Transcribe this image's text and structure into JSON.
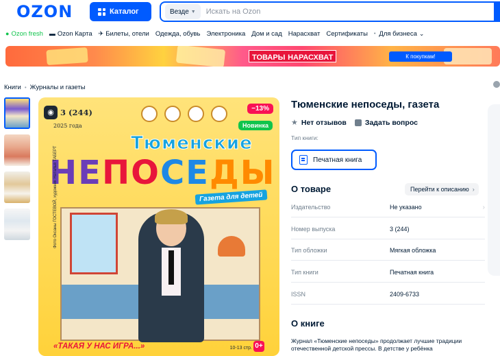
{
  "header": {
    "logo": "OZON",
    "catalog_label": "Каталог",
    "search_scope": "Везде",
    "search_placeholder": "Искать на Ozon"
  },
  "nav": {
    "items": [
      {
        "label": "Ozon fresh",
        "icon": "fresh-icon"
      },
      {
        "label": "Ozon Карта",
        "icon": "card-icon"
      },
      {
        "label": "Билеты, отели",
        "icon": "plane-icon"
      },
      {
        "label": "Одежда, обувь"
      },
      {
        "label": "Электроника"
      },
      {
        "label": "Дом и сад"
      },
      {
        "label": "Нарасхват"
      },
      {
        "label": "Сертификаты"
      },
      {
        "label": "Для бизнеса"
      }
    ]
  },
  "banner": {
    "title_main": "ТОВАРЫ",
    "title_sub": "НАРАСХВАТ",
    "cta": "К покупкам!"
  },
  "breadcrumbs": [
    "Книги",
    "Журналы и газеты"
  ],
  "cover": {
    "issue": "3 (244)",
    "year": "2025 года",
    "discount": "−13%",
    "new_badge": "Новинка",
    "title_top": "Тюменские",
    "title_big": [
      "НЕ",
      "ПО",
      "СЕ",
      "ДЫ"
    ],
    "subtitle": "Газета для детей",
    "bottom_text": "«ТАКАЯ У НАС ИГРА...»",
    "pages": "10-13 стр.",
    "age": "0+",
    "credit": "Фото Оксаны ГОСТЕВОЙ, художник Наталья ТАБЕРТ"
  },
  "product": {
    "title": "Тюменские непоседы, газета",
    "reviews": "Нет отзывов",
    "ask": "Задать вопрос",
    "book_type_label": "Тип книги:",
    "book_type_value": "Печатная книга"
  },
  "about_product": {
    "title": "О товаре",
    "goto": "Перейти к описанию",
    "specs": [
      {
        "key": "Издательство",
        "value": "Не указано"
      },
      {
        "key": "Номер выпуска",
        "value": "3 (244)"
      },
      {
        "key": "Тип обложки",
        "value": "Мягкая обложка"
      },
      {
        "key": "Тип книги",
        "value": "Печатная книга"
      },
      {
        "key": "ISSN",
        "value": "2409-6733"
      }
    ]
  },
  "about_book": {
    "title": "О книге",
    "text": "Журнал «Тюменские непоседы» продолжает лучшие традиции отечественной детской прессы. В детстве у ребёнка"
  },
  "colors": {
    "brand": "#005bff",
    "discount": "#f91155",
    "new": "#10c44c",
    "text": "#001a34",
    "muted": "#707f8d"
  }
}
